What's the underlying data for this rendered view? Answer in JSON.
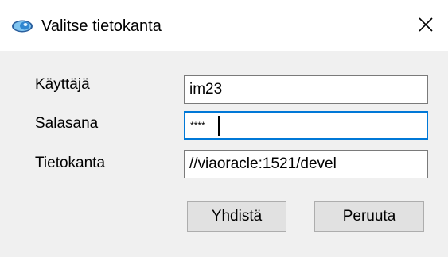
{
  "window": {
    "title": "Valitse tietokanta",
    "icon": "eye-icon",
    "close_glyph": "×"
  },
  "form": {
    "user_label": "Käyttäjä",
    "user_value": "im23",
    "password_label": "Salasana",
    "password_value": "****",
    "database_label": "Tietokanta",
    "database_value": "//viaoracle:1521/devel"
  },
  "buttons": {
    "connect_label": "Yhdistä",
    "cancel_label": "Peruuta"
  },
  "colors": {
    "focus_border": "#0078d7",
    "icon_blue": "#4aa3df"
  }
}
